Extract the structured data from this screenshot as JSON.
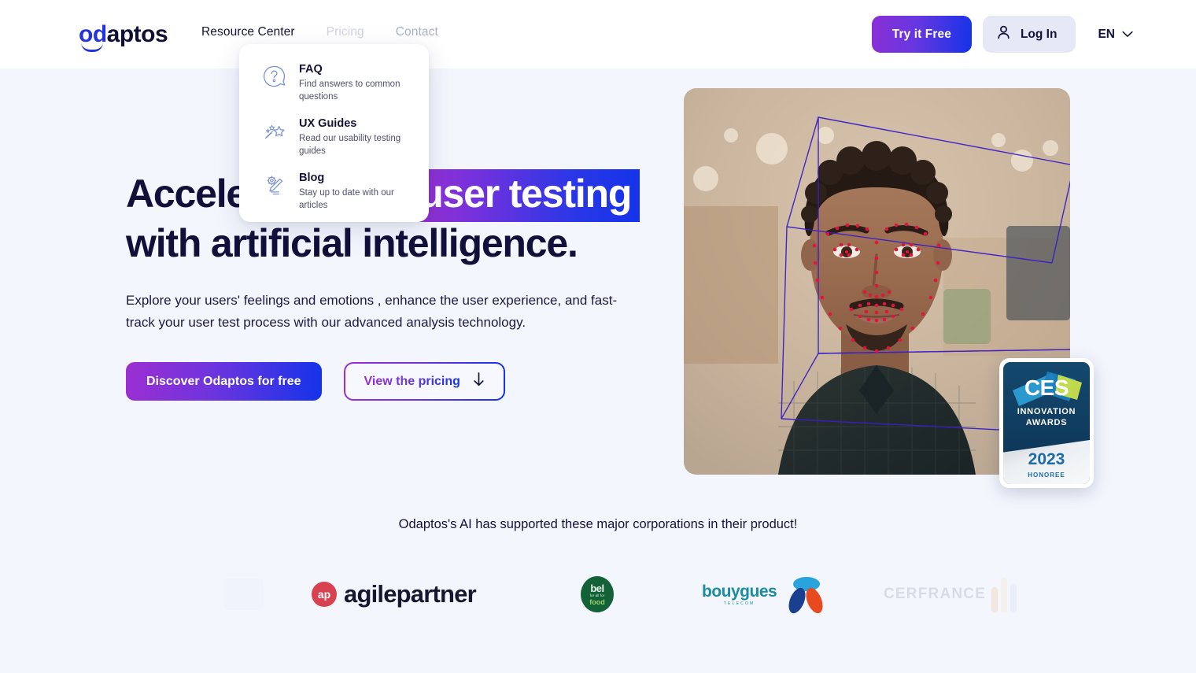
{
  "brand": {
    "logo_part1": "od",
    "logo_part2": "aptos"
  },
  "header": {
    "nav": [
      {
        "label": "Resource Center",
        "state": "active"
      },
      {
        "label": "Pricing",
        "state": "dim"
      },
      {
        "label": "Contact",
        "state": "dim2"
      }
    ],
    "try_free_label": "Try it Free",
    "login_label": "Log In",
    "language": "EN"
  },
  "dropdown": {
    "items": [
      {
        "icon": "question-bubble-icon",
        "title": "FAQ",
        "desc": "Find answers to common questions"
      },
      {
        "icon": "magic-wand-star-icon",
        "title": "UX Guides",
        "desc": "Read our usability testing guides"
      },
      {
        "icon": "pencil-write-icon",
        "title": "Blog",
        "desc": "Stay up to date with our articles"
      }
    ]
  },
  "hero": {
    "headline_line1_a": "Accelerate your",
    "headline_line1_b": "user testing",
    "headline_line2": "with artificial intelligence.",
    "subtext": "Explore your users' feelings and emotions , enhance the user experience, and fast-track your user test process with our advanced analysis technology.",
    "cta_primary": "Discover Odaptos for free",
    "cta_secondary": "View the pricing",
    "cta_secondary_icon": "arrow-down-icon"
  },
  "award": {
    "brand": "CES",
    "line1": "INNOVATION",
    "line2": "AWARDS",
    "year": "2023",
    "status": "HONOREE"
  },
  "clients": {
    "caption": "Odaptos's AI has supported these major corporations in their product!",
    "logos": [
      {
        "name": "agilepartner",
        "badge": "ap",
        "word": "agilepartner"
      },
      {
        "name": "bel",
        "top": "bel",
        "mid": "for all for",
        "bot": "food"
      },
      {
        "name": "bouygues-telecom",
        "word": "bouygues",
        "sub": "TELECOM"
      },
      {
        "name": "cerfrance",
        "word": "CERFRANCE"
      }
    ]
  },
  "colors": {
    "brand_blue": "#2433e0",
    "gradient_start": "#9b2fd2",
    "gradient_end": "#1433ea",
    "page_bg": "#f3f6fd",
    "header_bg": "#ffffff"
  }
}
